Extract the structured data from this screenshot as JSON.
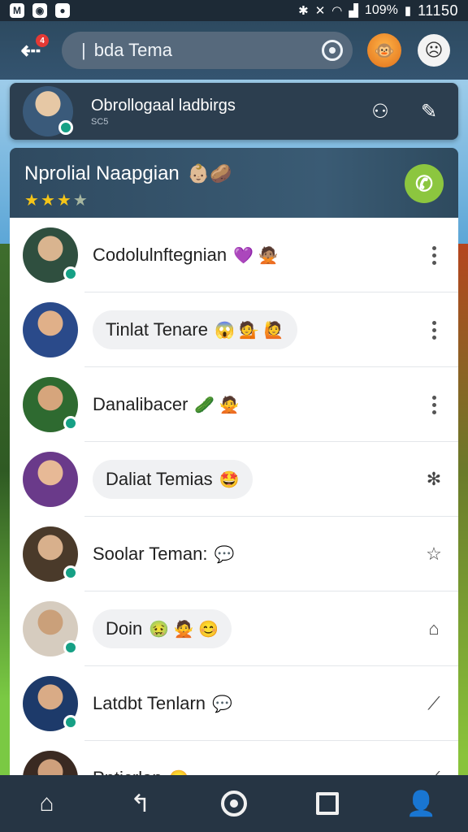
{
  "status_bar": {
    "battery": "109%",
    "time": "11150"
  },
  "app_bar": {
    "back_badge": "4",
    "search_value": "bda Tema"
  },
  "profile": {
    "name": "Obrollogaal ladbirgs",
    "sub": "SC5"
  },
  "group": {
    "title": "Nprolial Naapgian",
    "title_emoji": "👶🏼🥔",
    "rating": 3,
    "max_rating": 4
  },
  "contacts": [
    {
      "name": "Codolulnftegnian",
      "emoji": "💜 🙅🏽",
      "bubble": false,
      "action": "more-vert-icon"
    },
    {
      "name": "Tinlat Tenare",
      "emoji": "😱 💁 🙋",
      "bubble": true,
      "action": "drag-dots-icon"
    },
    {
      "name": "Danalibacer",
      "emoji": "🥒 🙅",
      "bubble": false,
      "action": "more-vert-icon"
    },
    {
      "name": "Daliat Temias",
      "emoji": "🤩",
      "bubble": true,
      "action": "puzzle-icon"
    },
    {
      "name": "Soolar Teman:",
      "emoji": "💬",
      "bubble": false,
      "action": "star-icon"
    },
    {
      "name": "Doin",
      "emoji": "🤢 🙅 😊",
      "bubble": true,
      "action": "edit-tag-icon"
    },
    {
      "name": "Latdbt Tenlarn",
      "emoji": "💬",
      "bubble": false,
      "action": "pin-icon"
    },
    {
      "name": "Pnticrlap",
      "emoji": "😊",
      "bubble": false,
      "action": "pin-icon"
    }
  ]
}
